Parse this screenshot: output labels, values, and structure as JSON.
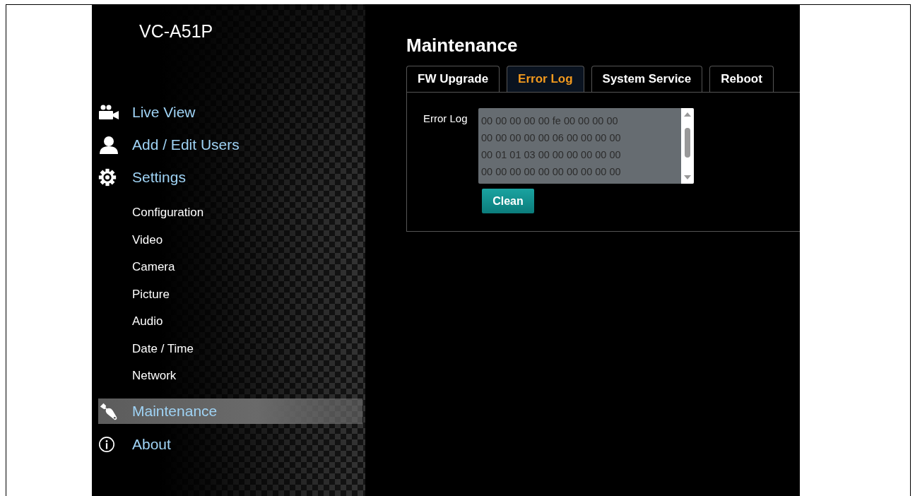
{
  "sidebar": {
    "title": "VC-A51P",
    "items": [
      {
        "label": "Live View",
        "kind": "camera",
        "selected": false
      },
      {
        "label": "Add / Edit Users",
        "kind": "user",
        "selected": false
      },
      {
        "label": "Settings",
        "kind": "gear",
        "selected": false,
        "children": [
          {
            "label": "Configuration",
            "selected": false
          },
          {
            "label": "Video",
            "selected": false
          },
          {
            "label": "Camera",
            "selected": false
          },
          {
            "label": "Picture",
            "selected": false
          },
          {
            "label": "Audio",
            "selected": false
          },
          {
            "label": "Date / Time",
            "selected": false
          },
          {
            "label": "Network",
            "selected": false
          }
        ]
      },
      {
        "label": "Maintenance",
        "kind": "wrench",
        "selected": true
      },
      {
        "label": "About",
        "kind": "info",
        "selected": false
      }
    ]
  },
  "main": {
    "heading": "Maintenance",
    "tabs": [
      {
        "label": "FW Upgrade",
        "selected": false
      },
      {
        "label": "Error Log",
        "selected": true
      },
      {
        "label": "System Service",
        "selected": false
      },
      {
        "label": "Reboot",
        "selected": false
      }
    ],
    "error_log": {
      "label": "Error Log",
      "lines": [
        "00 00 00 00 00 fe 00 00 00 00",
        "00 00 00 00 00 06 00 00 00 00",
        "00 01 01 03 00 00 00 00 00 00",
        "00 00 00 00 00 00 00 00 00 00"
      ]
    },
    "clean_button": "Clean"
  }
}
